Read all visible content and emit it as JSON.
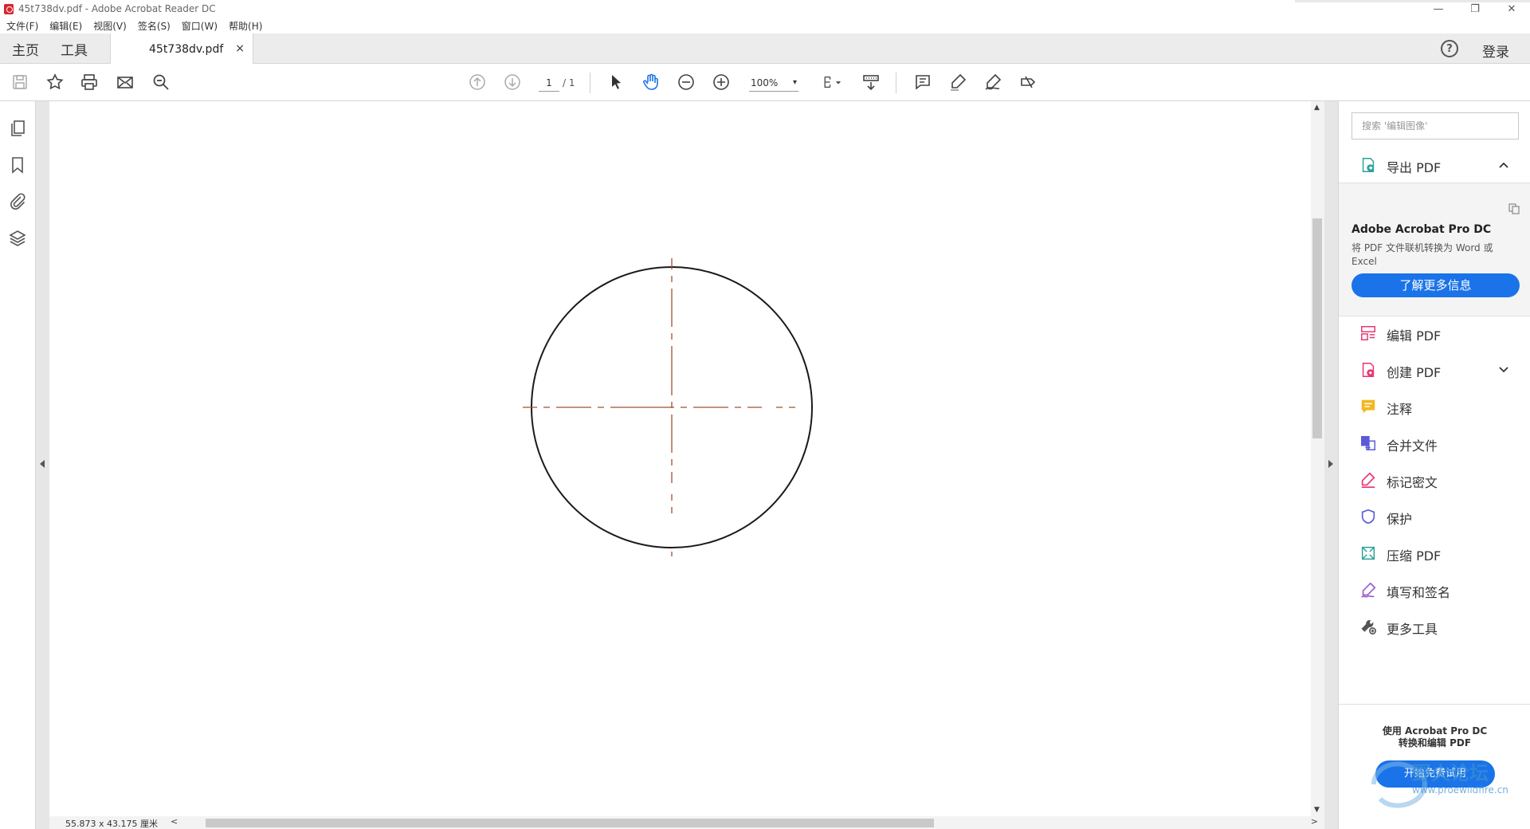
{
  "window": {
    "title": "45t738dv.pdf - Adobe Acrobat Reader DC",
    "minimize_glyph": "—",
    "restore_glyph": "❐",
    "close_glyph": "✕"
  },
  "menu": [
    "文件(F)",
    "编辑(E)",
    "视图(V)",
    "签名(S)",
    "窗口(W)",
    "帮助(H)"
  ],
  "tabs": {
    "home": "主页",
    "tools": "工具",
    "document": "45t738dv.pdf",
    "close": "×",
    "help": "?",
    "login": "登录"
  },
  "toolbar": {
    "page_current": "1",
    "page_total": "/ 1",
    "zoom": "100%",
    "zoom_caret": "▾"
  },
  "document": {
    "dimensions": "55.873 x 43.175 厘米",
    "scroll_left": "<",
    "scroll_right": ">",
    "scroll_up": "▲",
    "scroll_down": "▼",
    "line_color": "#1a1a1a",
    "centerline_color": "#a0522d"
  },
  "right_panel": {
    "search_placeholder": "搜索 '编辑图像'",
    "export": {
      "label": "导出 PDF"
    },
    "promo": {
      "title": "Adobe Acrobat Pro DC",
      "description": "将 PDF 文件联机转换为 Word 或 Excel",
      "button": "了解更多信息"
    },
    "tools": [
      {
        "label": "编辑 PDF",
        "icon": "edit-pdf-icon",
        "color": "#e8346e"
      },
      {
        "label": "创建 PDF",
        "icon": "create-pdf-icon",
        "color": "#e8346e"
      },
      {
        "label": "注释",
        "icon": "comment-icon",
        "color": "#f2b824"
      },
      {
        "label": "合并文件",
        "icon": "combine-files-icon",
        "color": "#5a5ad8"
      },
      {
        "label": "标记密文",
        "icon": "redact-icon",
        "color": "#e8346e"
      },
      {
        "label": "保护",
        "icon": "protect-icon",
        "color": "#5a5ad8"
      },
      {
        "label": "压缩 PDF",
        "icon": "compress-pdf-icon",
        "color": "#2aa198"
      },
      {
        "label": "填写和签名",
        "icon": "fill-sign-icon",
        "color": "#9b59d0"
      },
      {
        "label": "更多工具",
        "icon": "more-tools-icon",
        "color": "#555555"
      }
    ],
    "bottom": {
      "line1": "使用 Acrobat Pro DC",
      "line2": "转换和编辑 PDF",
      "button": "开始免费试用",
      "watermark": "野火论坛",
      "watermark_url": "www.proewildfire.cn"
    }
  },
  "colors": {
    "accent_blue": "#1a73e8",
    "acrobat_red": "#d6262d"
  }
}
